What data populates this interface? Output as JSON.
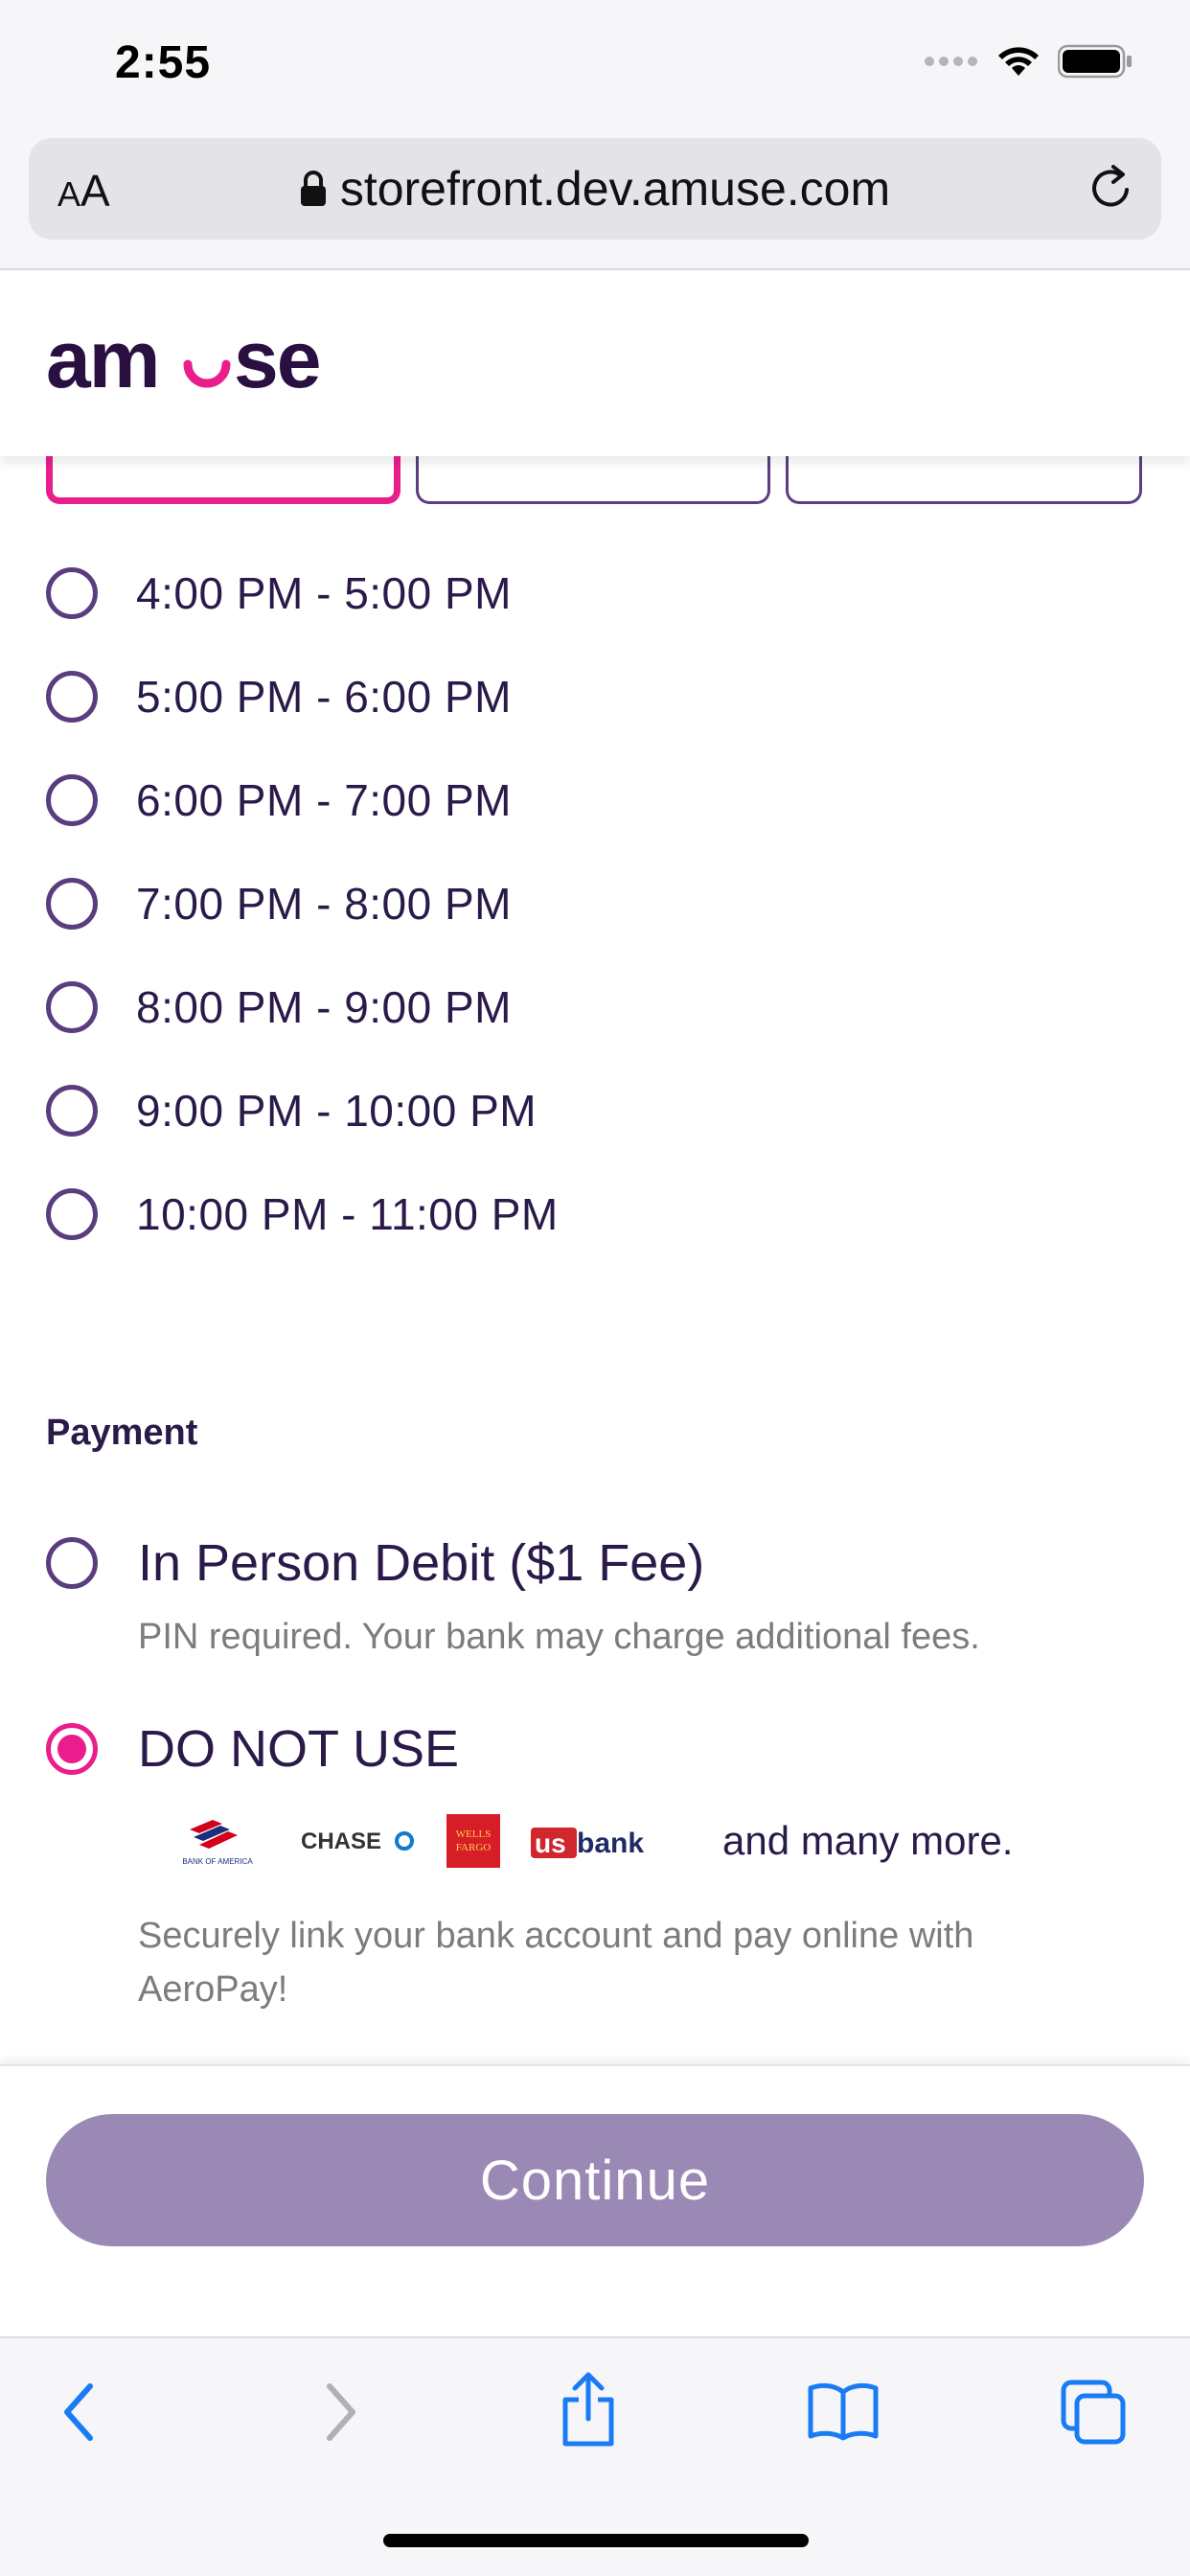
{
  "status_bar": {
    "time": "2:55"
  },
  "browser": {
    "aa_label_small": "A",
    "aa_label_large": "A",
    "url": "storefront.dev.amuse.com"
  },
  "brand": {
    "logo_text": "amuse"
  },
  "time_slots": [
    {
      "label": "4:00 PM - 5:00 PM",
      "selected": false
    },
    {
      "label": "5:00 PM - 6:00 PM",
      "selected": false
    },
    {
      "label": "6:00 PM - 7:00 PM",
      "selected": false
    },
    {
      "label": "7:00 PM - 8:00 PM",
      "selected": false
    },
    {
      "label": "8:00 PM - 9:00 PM",
      "selected": false
    },
    {
      "label": "9:00 PM - 10:00 PM",
      "selected": false
    },
    {
      "label": "10:00 PM - 11:00 PM",
      "selected": false
    }
  ],
  "payment": {
    "heading": "Payment",
    "options": [
      {
        "title": "In Person Debit ($1 Fee)",
        "description": "PIN required. Your bank may charge additional fees.",
        "selected": false
      },
      {
        "title": "DO NOT USE",
        "banks": [
          "BANK OF AMERICA",
          "CHASE",
          "WELLS FARGO",
          "usbank"
        ],
        "banks_more": "and many more.",
        "description_line1": "Securely link your bank account and pay online with",
        "description_line2": "AeroPay!",
        "selected": true
      }
    ]
  },
  "actions": {
    "continue_label": "Continue"
  },
  "colors": {
    "accent_pink": "#e91e8c",
    "brand_purple": "#5a3d7e",
    "text_dark": "#2a1a4a",
    "button_disabled": "#9b89b5",
    "ios_blue": "#1a7cf5"
  },
  "toolbar": {
    "icons": [
      "back-icon",
      "forward-icon",
      "share-icon",
      "bookmarks-icon",
      "tabs-icon"
    ]
  }
}
